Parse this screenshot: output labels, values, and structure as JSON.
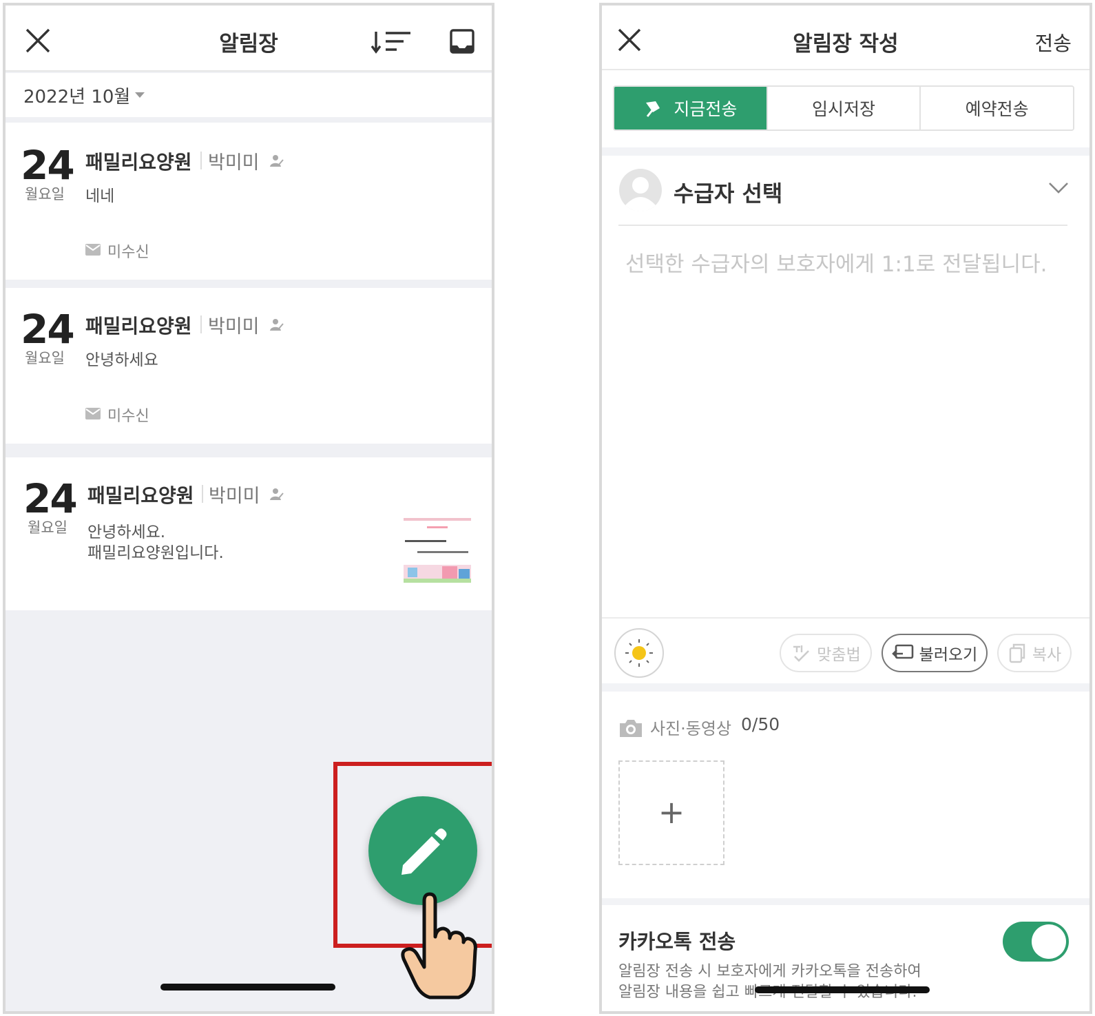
{
  "left": {
    "title": "알림장",
    "month": "2022년 10월",
    "cards": [
      {
        "day": "24",
        "weekday": "월요일",
        "org": "패밀리요양원",
        "author": "박미미",
        "body": "네네",
        "status": "미수신"
      },
      {
        "day": "24",
        "weekday": "월요일",
        "org": "패밀리요양원",
        "author": "박미미",
        "body": "안녕하세요",
        "status": "미수신"
      },
      {
        "day": "24",
        "weekday": "월요일",
        "org": "패밀리요양원",
        "author": "박미미",
        "body": "안녕하세요.\n패밀리요양원입니다."
      }
    ]
  },
  "right": {
    "title": "알림장 작성",
    "send": "전송",
    "modes": [
      "지금전송",
      "임시저장",
      "예약전송"
    ],
    "recipient_select": "수급자 선택",
    "placeholder": "선택한 수급자의 보호자에게 1:1로 전달됩니다.",
    "tools": {
      "spellcheck": "맞춤법",
      "load": "불러오기",
      "copy": "복사"
    },
    "media": {
      "label": "사진·동영상",
      "count": "0/50"
    },
    "kakao": {
      "title": "카카오톡 전송",
      "desc": "알림장 전송 시 보호자에게 카카오톡을 전송하여\n알림장 내용을 쉽고 빠르게 전달할 수 있습니다.",
      "enabled": true
    }
  },
  "colors": {
    "accent": "#2e9e6e",
    "highlight": "#cc1f1f"
  }
}
